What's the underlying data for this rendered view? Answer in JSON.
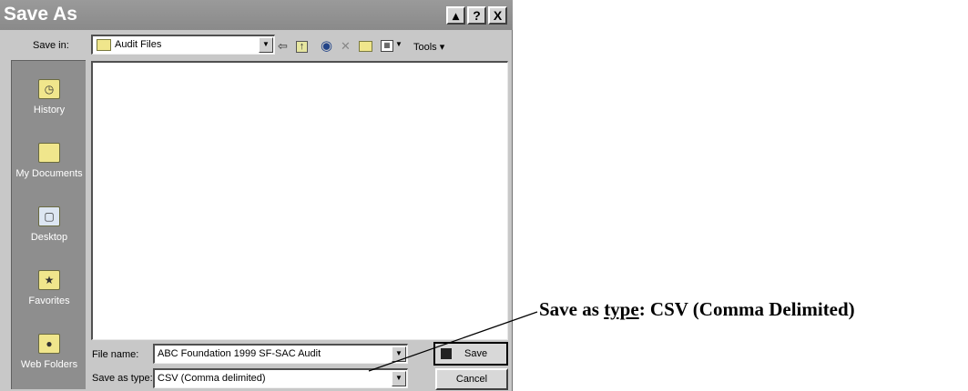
{
  "window": {
    "title": "Save As",
    "controls": [
      "?",
      "X"
    ]
  },
  "save_in": {
    "label": "Save in:",
    "value": "Audit Files"
  },
  "toolbar": {
    "icons": [
      "back-arrow-icon",
      "up-folder-icon",
      "search-web-icon",
      "delete-icon",
      "new-folder-icon",
      "views-icon"
    ],
    "tools_label": "Tools"
  },
  "places_bar": [
    {
      "label": "History",
      "icon": "history-icon"
    },
    {
      "label": "My Documents",
      "icon": "my-documents-icon"
    },
    {
      "label": "Desktop",
      "icon": "desktop-icon"
    },
    {
      "label": "Favorites",
      "icon": "favorites-icon"
    },
    {
      "label": "Web Folders",
      "icon": "web-folders-icon"
    }
  ],
  "file_name": {
    "label": "File name:",
    "value": "ABC Foundation 1999 SF-SAC Audit"
  },
  "save_as_type": {
    "label": "Save as type:",
    "value": "CSV (Comma delimited)"
  },
  "buttons": {
    "save": "Save",
    "cancel": "Cancel"
  },
  "annotation": {
    "prefix": "Save as ",
    "underlined": "type",
    "suffix": ": CSV (Comma Delimited)"
  }
}
